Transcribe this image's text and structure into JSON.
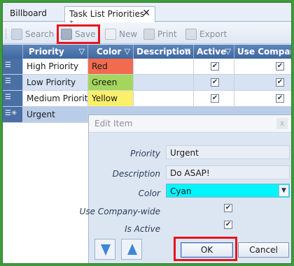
{
  "tabs": [
    {
      "label": "Billboard"
    },
    {
      "label": "Task List Priorities *"
    }
  ],
  "toolbar": {
    "search_label": "Search",
    "save_label": "Save",
    "new_label": "New",
    "print_label": "Print",
    "export_label": "Export"
  },
  "grid": {
    "columns": [
      "Priority",
      "Color",
      "Description",
      "Active",
      "Use Company-"
    ],
    "rows": [
      {
        "priority": "High Priority",
        "color": "Red",
        "color_hex": "#f26b4f",
        "description": "",
        "active": true,
        "company": true
      },
      {
        "priority": "Low Priority",
        "color": "Green",
        "color_hex": "#a4d65e",
        "description": "",
        "active": true,
        "company": true
      },
      {
        "priority": "Medium Priority",
        "color": "Yellow",
        "color_hex": "#fbf06a",
        "description": "",
        "active": true,
        "company": true
      },
      {
        "priority": "Urgent",
        "color": "",
        "color_hex": "",
        "description": "",
        "active": false,
        "company": false
      }
    ]
  },
  "dialog": {
    "title": "Edit Item",
    "close_glyph": "x",
    "fields": {
      "priority_label": "Priority",
      "priority_value": "Urgent",
      "description_label": "Description",
      "description_value": "Do ASAP!",
      "color_label": "Color",
      "color_value": "Cyan",
      "company_label": "Use Company-wide",
      "active_label": "Is Active"
    },
    "ok_label": "OK",
    "cancel_label": "Cancel"
  },
  "colors": {
    "header": "#4a72a8",
    "highlight": "#e8141c",
    "cyan": "#00f5ff",
    "window_border": "#3f9a3c"
  }
}
